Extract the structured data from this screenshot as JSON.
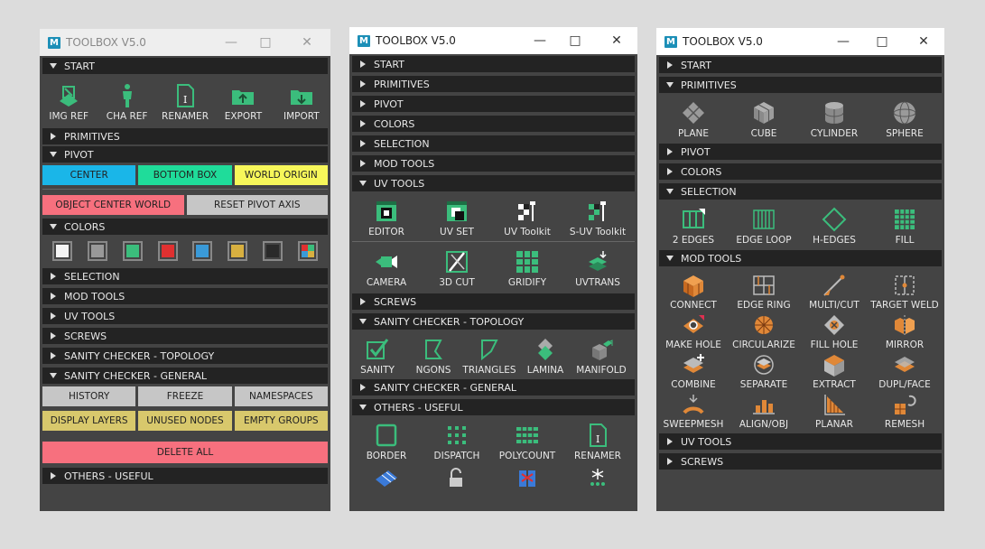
{
  "app_title": "TOOLBOX V5.0",
  "logo": "M",
  "win1": {
    "start": "START",
    "start_tools": [
      "IMG REF",
      "CHA REF",
      "RENAMER",
      "EXPORT",
      "IMPORT"
    ],
    "primitives": "PRIMITIVES",
    "pivot": "PIVOT",
    "pivot_row1": [
      "CENTER",
      "BOTTOM BOX",
      "WORLD ORIGIN"
    ],
    "pivot_row2": [
      "OBJECT CENTER WORLD",
      "RESET PIVOT AXIS"
    ],
    "colors": "COLORS",
    "selection": "SELECTION",
    "mod_tools": "MOD TOOLS",
    "uv_tools": "UV TOOLS",
    "screws": "SCREWS",
    "sanity_topology": "SANITY CHECKER - TOPOLOGY",
    "sanity_general": "SANITY CHECKER - GENERAL",
    "general_row1": [
      "HISTORY",
      "FREEZE",
      "NAMESPACES"
    ],
    "general_row2": [
      "DISPLAY LAYERS",
      "UNUSED NODES",
      "EMPTY GROUPS"
    ],
    "delete_all": "DELETE ALL",
    "others": "OTHERS - USEFUL"
  },
  "win2": {
    "sections_top": [
      "START",
      "PRIMITIVES",
      "PIVOT",
      "COLORS",
      "SELECTION",
      "MOD TOOLS"
    ],
    "uv_tools": "UV TOOLS",
    "uv_row1": [
      "EDITOR",
      "UV SET",
      "UV Toolkit",
      "S-UV Toolkit"
    ],
    "uv_row2": [
      "CAMERA",
      "3D CUT",
      "GRIDIFY",
      "UVTRANS"
    ],
    "screws": "SCREWS",
    "sanity_topology": "SANITY CHECKER - TOPOLOGY",
    "topo_tools": [
      "SANITY",
      "NGONS",
      "TRIANGLES",
      "LAMINA",
      "MANIFOLD"
    ],
    "sanity_general": "SANITY CHECKER - GENERAL",
    "others": "OTHERS - USEFUL",
    "others_tools": [
      "BORDER",
      "DISPATCH",
      "POLYCOUNT",
      "RENAMER"
    ]
  },
  "win3": {
    "start": "START",
    "primitives": "PRIMITIVES",
    "prim_tools": [
      "PLANE",
      "CUBE",
      "CYLINDER",
      "SPHERE"
    ],
    "pivot": "PIVOT",
    "colors": "COLORS",
    "selection": "SELECTION",
    "sel_tools": [
      "2 EDGES",
      "EDGE LOOP",
      "H-EDGES",
      "FILL"
    ],
    "mod_tools": "MOD TOOLS",
    "mod_row1": [
      "CONNECT",
      "EDGE RING",
      "MULTI/CUT",
      "TARGET WELD"
    ],
    "mod_row2": [
      "MAKE HOLE",
      "CIRCULARIZE",
      "FILL HOLE",
      "MIRROR"
    ],
    "mod_row3": [
      "COMBINE",
      "SEPARATE",
      "EXTRACT",
      "DUPL/FACE"
    ],
    "mod_row4": [
      "SWEEPMESH",
      "ALIGN/OBJ",
      "PLANAR",
      "REMESH"
    ],
    "uv_tools": "UV TOOLS",
    "screws": "SCREWS"
  },
  "colors": {
    "cyan": "#1ab6e8",
    "green": "#1fdc9a",
    "yellow": "#f7f75a",
    "pink": "#f7707e",
    "gray": "#c6c6c6",
    "khaki": "#d8c86c",
    "icon_green": "#3bbd7c",
    "icon_orange": "#e08838"
  }
}
